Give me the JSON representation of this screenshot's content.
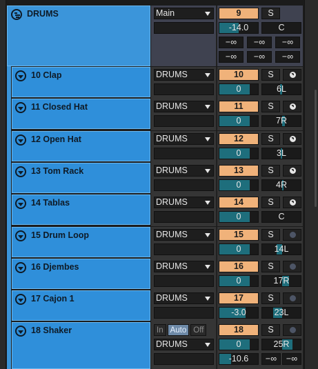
{
  "group": {
    "name": "DRUMS",
    "output": "Main",
    "number": "9",
    "solo": "S",
    "volume": "-14.0",
    "pan": "C",
    "sends": [
      "−∞",
      "−∞",
      "−∞",
      "−∞",
      "−∞",
      "−∞"
    ]
  },
  "tracks": [
    {
      "name": "10 Clap",
      "output": "DRUMS",
      "number": "10",
      "solo": "S",
      "volume": "0",
      "pan": "6L",
      "arm_state": "monitor",
      "pan_fraction": -0.12
    },
    {
      "name": "11 Closed Hat",
      "output": "DRUMS",
      "number": "11",
      "solo": "S",
      "volume": "0",
      "pan": "7R",
      "arm_state": "monitor",
      "pan_fraction": 0.14
    },
    {
      "name": "12 Open Hat",
      "output": "DRUMS",
      "number": "12",
      "solo": "S",
      "volume": "0",
      "pan": "3L",
      "arm_state": "monitor",
      "pan_fraction": -0.06
    },
    {
      "name": "13 Tom Rack",
      "output": "DRUMS",
      "number": "13",
      "solo": "S",
      "volume": "0",
      "pan": "4R",
      "arm_state": "monitor",
      "pan_fraction": 0.08
    },
    {
      "name": "14 Tablas",
      "output": "DRUMS",
      "number": "14",
      "solo": "S",
      "volume": "0",
      "pan": "C",
      "arm_state": "monitor",
      "pan_fraction": 0.0
    },
    {
      "name": "15 Drum Loop",
      "output": "DRUMS",
      "number": "15",
      "solo": "S",
      "volume": "0",
      "pan": "14L",
      "arm_state": "arm",
      "pan_fraction": -0.28
    },
    {
      "name": "16 Djembes",
      "output": "DRUMS",
      "number": "16",
      "solo": "S",
      "volume": "0",
      "pan": "17R",
      "arm_state": "arm",
      "pan_fraction": 0.34
    },
    {
      "name": "17 Cajon 1",
      "output": "DRUMS",
      "number": "17",
      "solo": "S",
      "volume": "-3.0",
      "pan": "23L",
      "arm_state": "arm",
      "pan_fraction": -0.46
    },
    {
      "name": "18 Shaker",
      "output": "DRUMS",
      "number": "18",
      "solo": "S",
      "volume": "0",
      "pan": "25R",
      "arm_state": "arm",
      "pan_fraction": 0.5,
      "monitor": {
        "in": "In",
        "auto": "Auto",
        "off": "Off",
        "selected": "Auto"
      },
      "extra": {
        "volume": "-10.6",
        "sends": [
          "−∞",
          "−∞"
        ]
      }
    }
  ],
  "colors": {
    "track": "#2f8fda",
    "number": "#f0b27a",
    "level_fill": "#1e6e7c"
  },
  "levels": {
    "group_volume": 0.5,
    "track_volume": 0.78,
    "cajon_volume": 0.68,
    "shaker_extra": 0.3
  }
}
